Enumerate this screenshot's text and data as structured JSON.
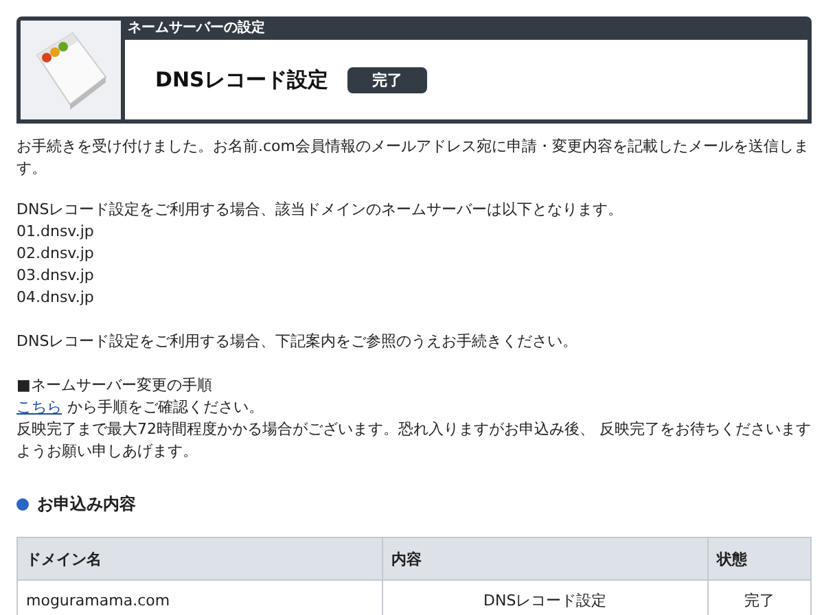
{
  "header": {
    "section": "ネームサーバーの設定",
    "title": "DNSレコード設定",
    "status": "完了"
  },
  "intro": "お手続きを受け付けました。お名前.com会員情報のメールアドレス宛に申請・変更内容を記載したメールを送信します。",
  "nameserver_note": "DNSレコード設定をご利用する場合、該当ドメインのネームサーバーは以下となります。",
  "nameservers": [
    "01.dnsv.jp",
    "02.dnsv.jp",
    "03.dnsv.jp",
    "04.dnsv.jp"
  ],
  "guide_note": "DNSレコード設定をご利用する場合、下記案内をご参照のうえお手続きください。",
  "procedure": {
    "heading": "■ネームサーバー変更の手順",
    "link": "こちら",
    "link_text": "から手順をご確認ください。",
    "notice": "反映完了まで最大72時間程度かかる場合がございます。恐れ入りますがお申込み後、 反映完了をお待ちくださいますようお願い申しあげます。"
  },
  "application": {
    "heading": "お申込み内容",
    "columns": [
      "ドメイン名",
      "内容",
      "状態"
    ],
    "rows": [
      [
        "moguramama.com",
        "DNSレコード設定",
        "完了"
      ]
    ]
  }
}
